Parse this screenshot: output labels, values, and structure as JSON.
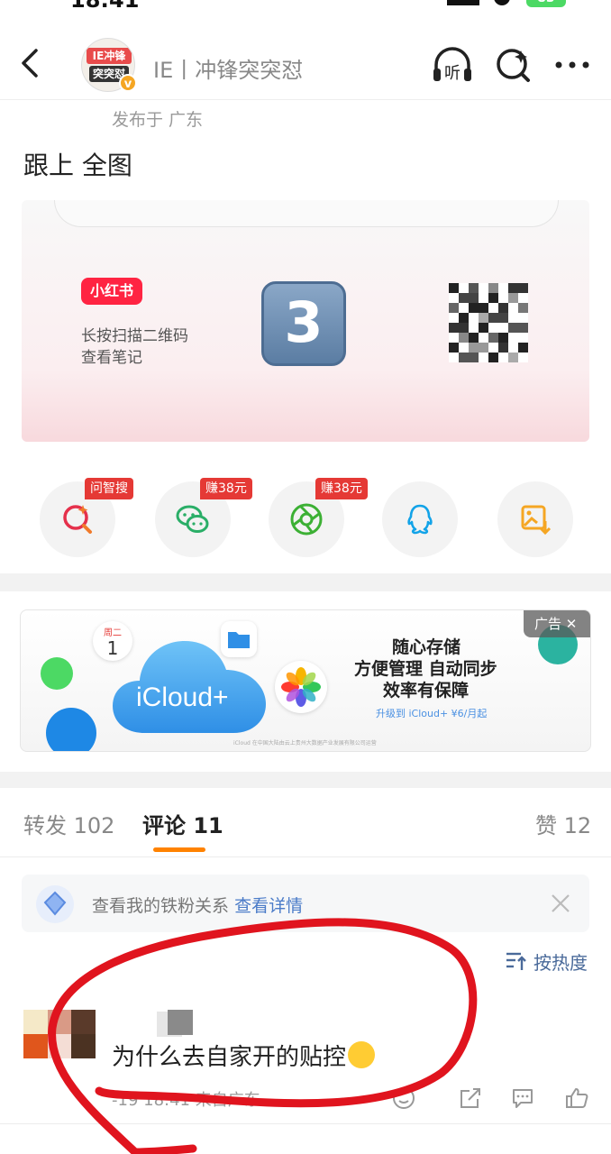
{
  "status_bar": {
    "time": "18:41",
    "battery": "83"
  },
  "header": {
    "avatar_text_1": "IE冲锋",
    "avatar_text_2": "突突怼",
    "verified_badge": "v",
    "title": "IE丨冲锋突突怼",
    "listen_label": "听"
  },
  "post": {
    "publish_location": "发布于 广东",
    "text": "跟上 全图",
    "share_card": {
      "app_logo": "小红书",
      "line1": "长按扫描二维码",
      "line2": "查看笔记",
      "emoji_number": "3"
    }
  },
  "share_buttons": [
    {
      "name": "ask-search",
      "tag": "问智搜",
      "icon": "ask-search-icon"
    },
    {
      "name": "wechat",
      "tag": "赚38元",
      "icon": "wechat-icon"
    },
    {
      "name": "moments",
      "tag": "赚38元",
      "icon": "moments-icon"
    },
    {
      "name": "qq",
      "tag": "",
      "icon": "qq-icon"
    },
    {
      "name": "save-image",
      "tag": "",
      "icon": "save-image-icon"
    }
  ],
  "ad": {
    "tag": "广告",
    "product": "iCloud+",
    "calendar_weekday": "周二",
    "calendar_day": "1",
    "line1": "随心存储",
    "line2": "方便管理 自动同步",
    "line3": "效率有保障",
    "cta": "升级到 iCloud+ ¥6/月起",
    "fine_print": "iCloud 在中国大陆由云上贵州大数据产业发展有限公司运营"
  },
  "tabs": {
    "repost": "转发 102",
    "comments": "评论 11",
    "likes": "赞 12"
  },
  "fan_bar": {
    "text": "查看我的铁粉关系",
    "link": "查看详情"
  },
  "sort": {
    "label": "按热度"
  },
  "comment": {
    "text": "为什么去自家开的贴控",
    "meta": "-19 18:41 来自广东"
  },
  "colors": {
    "accent_orange": "#ff8200",
    "link_blue": "#4a7bc8",
    "annotation_red": "#e0141e",
    "tag_red": "#e53935"
  }
}
